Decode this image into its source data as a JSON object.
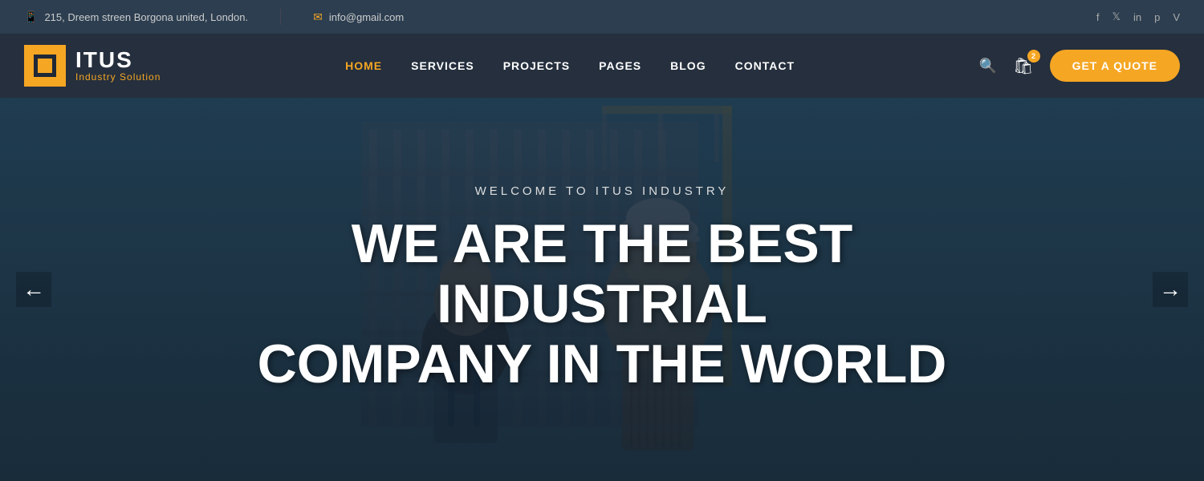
{
  "topbar": {
    "address_icon": "📱",
    "address": "215, Dreem streen Borgona united, London.",
    "email_icon": "✉",
    "email": "info@gmail.com",
    "social": [
      {
        "name": "facebook",
        "label": "f"
      },
      {
        "name": "twitter",
        "label": "𝕏"
      },
      {
        "name": "linkedin",
        "label": "in"
      },
      {
        "name": "pinterest",
        "label": "p"
      },
      {
        "name": "vimeo",
        "label": "V"
      }
    ]
  },
  "header": {
    "logo_name": "ITUS",
    "logo_tagline": "Industry Solution",
    "nav_items": [
      {
        "label": "HOME",
        "active": true
      },
      {
        "label": "SERVICES",
        "active": false
      },
      {
        "label": "PROJECTS",
        "active": false
      },
      {
        "label": "PAGES",
        "active": false
      },
      {
        "label": "BLOG",
        "active": false
      },
      {
        "label": "CONTACT",
        "active": false
      }
    ],
    "cart_count": "2",
    "quote_label": "GET A QUOTE"
  },
  "hero": {
    "subtitle": "WELCOME TO ITUS INDUSTRY",
    "title_line1": "WE ARE THE BEST INDUSTRIAL",
    "title_line2": "COMPANY IN THE WORLD"
  },
  "slider": {
    "left_arrow": "←",
    "right_arrow": "→"
  }
}
